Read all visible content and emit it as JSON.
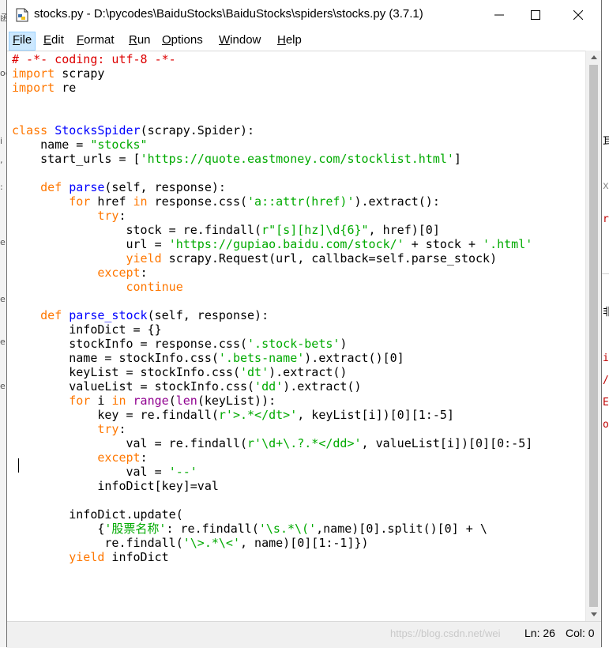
{
  "window": {
    "title": "stocks.py - D:\\pycodes\\BaiduStocks\\BaiduStocks\\spiders\\stocks.py (3.7.1)"
  },
  "menu": [
    {
      "label": "File",
      "key": "F",
      "rest": "ile"
    },
    {
      "label": "Edit",
      "key": "E",
      "rest": "dit"
    },
    {
      "label": "Format",
      "key": "F",
      "rest": "ormat"
    },
    {
      "label": "Run",
      "key": "R",
      "rest": "un"
    },
    {
      "label": "Options",
      "key": "O",
      "rest": "ptions"
    },
    {
      "label": "Window",
      "key": "W",
      "rest": "indow"
    },
    {
      "label": "Help",
      "key": "H",
      "rest": "elp"
    }
  ],
  "code_lines": [
    "# -*- coding: utf-8 -*-",
    "import scrapy",
    "import re",
    "",
    "",
    "class StocksSpider(scrapy.Spider):",
    "    name = \"stocks\"",
    "    start_urls = ['https://quote.eastmoney.com/stocklist.html']",
    "",
    "    def parse(self, response):",
    "        for href in response.css('a::attr(href)').extract():",
    "            try:",
    "                stock = re.findall(r\"[s][hz]\\d{6}\", href)[0]",
    "                url = 'https://gupiao.baidu.com/stock/' + stock + '.html'",
    "                yield scrapy.Request(url, callback=self.parse_stock)",
    "            except:",
    "                continue",
    "",
    "    def parse_stock(self, response):",
    "        infoDict = {}",
    "        stockInfo = response.css('.stock-bets')",
    "        name = stockInfo.css('.bets-name').extract()[0]",
    "        keyList = stockInfo.css('dt').extract()",
    "        valueList = stockInfo.css('dd').extract()",
    "        for i in range(len(keyList)):",
    "            key = re.findall(r'>.*</dt>', keyList[i])[0][1:-5]",
    "            try:",
    "                val = re.findall(r'\\d+\\.?.*</dd>', valueList[i])[0][0:-5]",
    "            except:",
    "                val = '--'",
    "            infoDict[key]=val",
    "",
    "        infoDict.update(",
    "            {'股票名称': re.findall('\\s.*\\(',name)[0].split()[0] + \\",
    "             re.findall('\\>.*\\<', name)[0][1:-1]})",
    "        yield infoDict"
  ],
  "status": {
    "watermark": "https://blog.csdn.net/wei",
    "line": "Ln: 26",
    "col": "Col: 0"
  },
  "colors": {
    "keyword": "#ff7700",
    "string": "#00aa00",
    "comment": "#dd0000",
    "definition": "#0000ff",
    "builtin": "#900090",
    "menu_highlight": "#cce8ff"
  },
  "background_glyphs": {
    "left": [
      "i",
      ",",
      ":",
      "e",
      "e",
      "e",
      "e"
    ],
    "right": [
      "耳",
      "x",
      "r",
      "非",
      "i",
      "/",
      "E",
      "o"
    ]
  }
}
